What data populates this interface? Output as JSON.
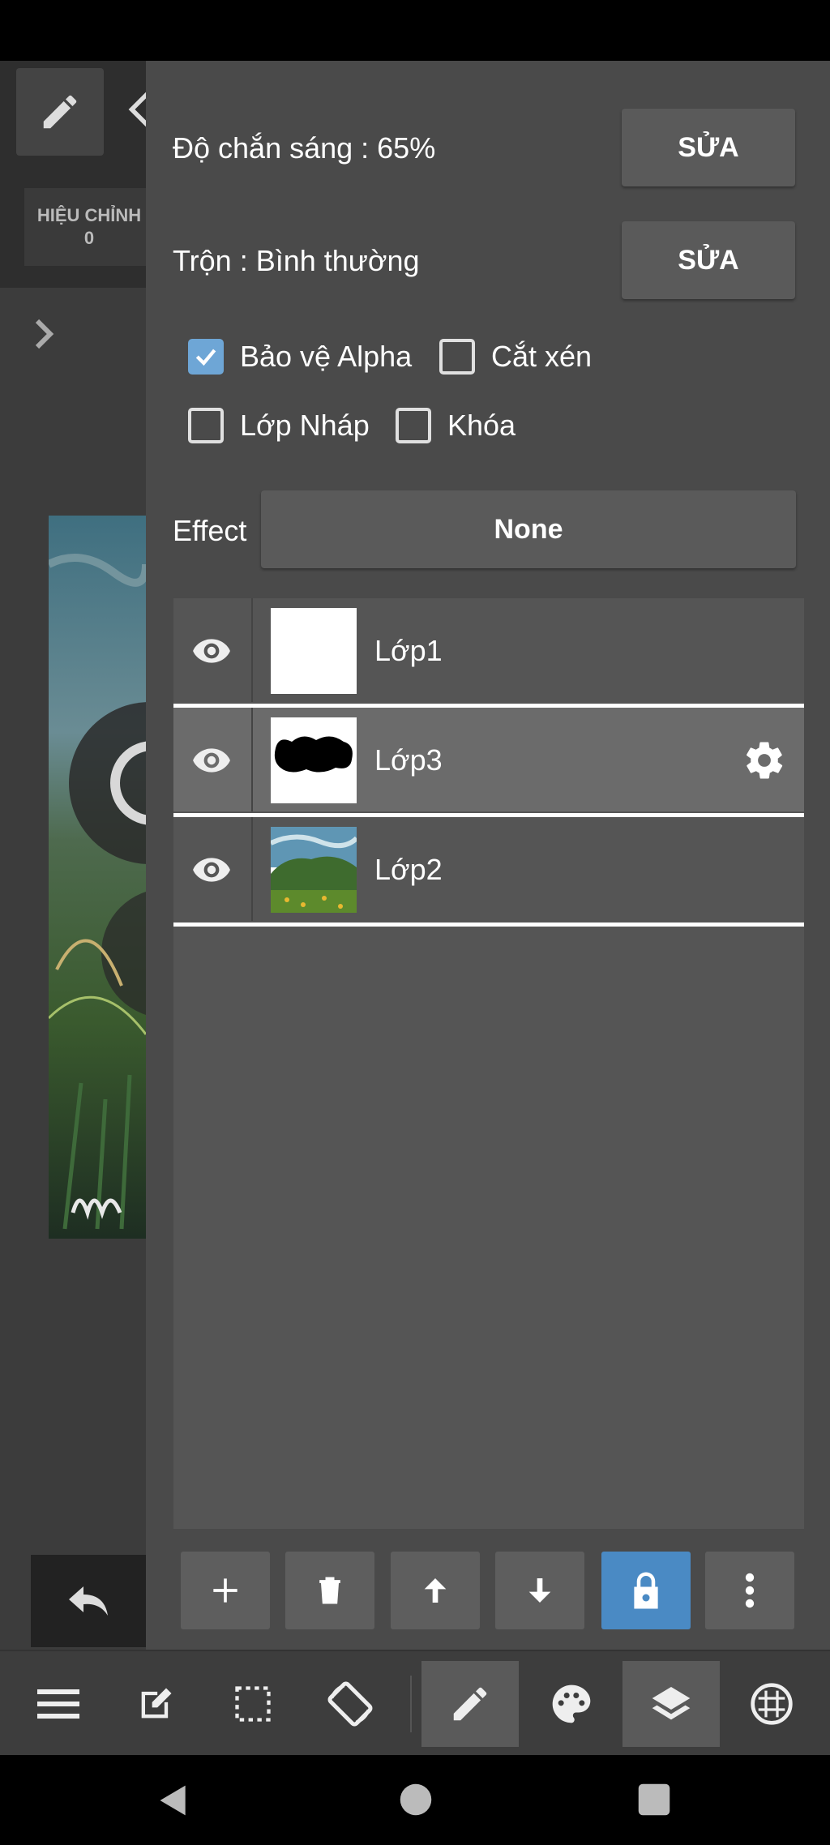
{
  "panel": {
    "opacity_label": "Độ chắn sáng : 65%",
    "opacity_edit": "SỬA",
    "blend_label": "Trộn : Bình thường",
    "blend_edit": "SỬA",
    "checkboxes": {
      "alpha_protect": {
        "label": "Bảo vệ Alpha",
        "checked": true
      },
      "clipping": {
        "label": "Cắt xén",
        "checked": false
      },
      "draft_layer": {
        "label": "Lớp Nháp",
        "checked": false
      },
      "lock": {
        "label": "Khóa",
        "checked": false
      }
    },
    "effect_label": "Effect",
    "effect_value": "None"
  },
  "layers": [
    {
      "name": "Lớp1",
      "visible": true,
      "selected": false
    },
    {
      "name": "Lớp3",
      "visible": true,
      "selected": true
    },
    {
      "name": "Lớp2",
      "visible": true,
      "selected": false
    }
  ],
  "left_strip": {
    "adjust_label": "HIỆU CHỈNH",
    "adjust_value": "0"
  },
  "icons": {
    "layer_actions": [
      "plus-icon",
      "trash-icon",
      "arrow-up-icon",
      "arrow-down-icon",
      "lock-icon",
      "more-vertical-icon"
    ],
    "toolbar": [
      "menu-icon",
      "edit-canvas-icon",
      "selection-icon",
      "rotate-screen-icon",
      "brush-icon",
      "palette-icon",
      "layers-icon",
      "grid-icon"
    ],
    "nav": [
      "back-icon",
      "home-icon",
      "recents-icon"
    ]
  },
  "colors": {
    "panel_bg": "#4a4a4a",
    "button_bg": "#5a5a5a",
    "accent_blue": "#4a8ac4",
    "checkbox_checked": "#6ea6d6"
  }
}
